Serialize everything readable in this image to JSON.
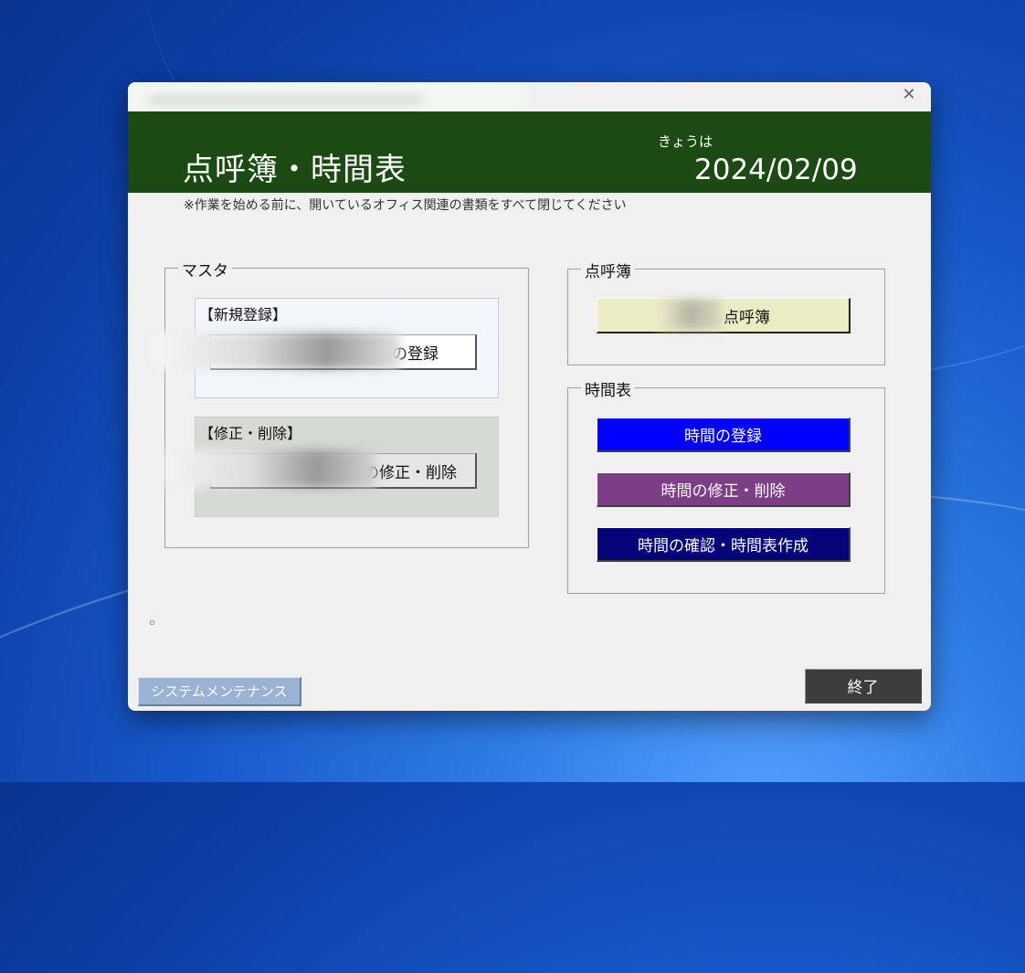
{
  "window": {
    "close_glyph": "✕",
    "title_text": "点呼簿・時間表",
    "today_label": "きょうは",
    "date": "2024/02/09",
    "notice": "※作業を始める前に、開いているオフィス関連の書類をすべて閉じてください",
    "header_color": "#1b4a12"
  },
  "master": {
    "label": "マスタ",
    "new_section": {
      "label": "【新規登録】",
      "button_label": "の登録"
    },
    "edit_section": {
      "label": "【修正・削除】",
      "button_label": "の修正・削除"
    }
  },
  "tenko": {
    "label": "点呼簿",
    "button_label": "点呼簿"
  },
  "schedule": {
    "label": "時間表",
    "register_label": "時間の登録",
    "edit_label": "時間の修正・削除",
    "confirm_label": "時間の確認・時間表作成"
  },
  "footer": {
    "maintenance_label": "システムメンテナンス",
    "exit_label": "終了",
    "small_mark": "ｏ"
  },
  "colors": {
    "register": "#0000ff",
    "edit": "#7c3f86",
    "confirm": "#050478",
    "tenko_button": "#ececc4",
    "edit_section_bg": "#d5dad2",
    "new_section_bg": "#f2f6fb"
  }
}
